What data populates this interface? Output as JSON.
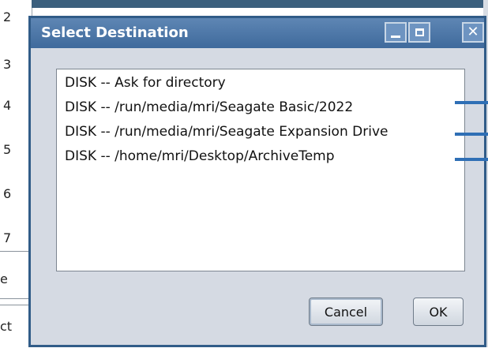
{
  "background": {
    "row_numbers": [
      "2",
      "3",
      "4",
      "5",
      "6",
      "7"
    ],
    "fragments": [
      "e",
      "ct"
    ]
  },
  "dialog": {
    "title": "Select Destination",
    "destinations": [
      "DISK -- Ask for directory",
      "DISK -- /run/media/mri/Seagate Basic/2022",
      "DISK -- /run/media/mri/Seagate Expansion Drive",
      "DISK -- /home/mri/Desktop/ArchiveTemp"
    ],
    "cancel_label": "Cancel",
    "ok_label": "OK"
  },
  "colors": {
    "titlebar": "#4a76a8",
    "dialog_bg": "#d5dae3",
    "border": "#315c88"
  }
}
